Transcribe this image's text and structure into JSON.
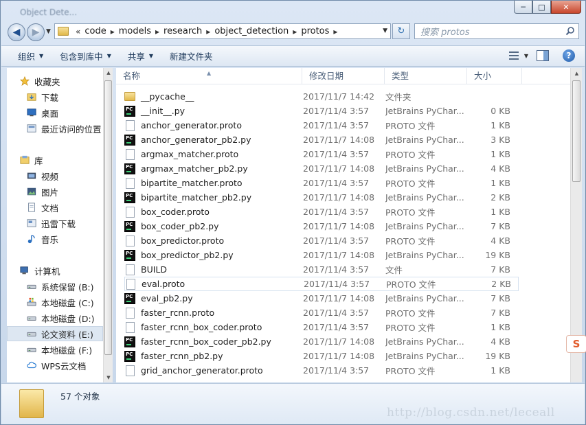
{
  "window": {
    "title": "Object Dete...",
    "controls": {
      "minimize": "─",
      "maximize": "□",
      "close": "✕"
    }
  },
  "navigation": {
    "back_icon": "arrow-left-icon",
    "forward_icon": "arrow-right-icon",
    "breadcrumb": [
      "code",
      "models",
      "research",
      "object_detection",
      "protos"
    ],
    "overflow": "«",
    "search_placeholder": "搜索 protos"
  },
  "toolbar": {
    "organize": "组织",
    "include_in_library": "包含到库中",
    "share": "共享",
    "new_folder": "新建文件夹"
  },
  "sidebar": {
    "items": [
      {
        "label": "收藏夹",
        "icon": "star-icon"
      },
      {
        "label": "下载",
        "icon": "download-folder-icon"
      },
      {
        "label": "桌面",
        "icon": "desktop-icon"
      },
      {
        "label": "最近访问的位置",
        "icon": "recent-places-icon"
      },
      {
        "label": "库",
        "icon": "library-icon"
      },
      {
        "label": "视频",
        "icon": "video-icon"
      },
      {
        "label": "图片",
        "icon": "picture-icon"
      },
      {
        "label": "文档",
        "icon": "document-icon"
      },
      {
        "label": "迅雷下载",
        "icon": "thunder-download-icon"
      },
      {
        "label": "音乐",
        "icon": "music-icon"
      },
      {
        "label": "计算机",
        "icon": "computer-icon"
      },
      {
        "label": "系统保留 (B:)",
        "icon": "drive-icon"
      },
      {
        "label": "本地磁盘 (C:)",
        "icon": "system-drive-icon"
      },
      {
        "label": "本地磁盘 (D:)",
        "icon": "drive-icon"
      },
      {
        "label": "论文资料 (E:)",
        "icon": "drive-icon"
      },
      {
        "label": "本地磁盘 (F:)",
        "icon": "drive-icon"
      },
      {
        "label": "WPS云文档",
        "icon": "cloud-icon"
      }
    ]
  },
  "file_list": {
    "columns": {
      "name": "名称",
      "date": "修改日期",
      "type": "类型",
      "size": "大小"
    },
    "rows": [
      {
        "name": "__pycache__",
        "date": "2017/11/7 14:42",
        "type": "文件夹",
        "size": "",
        "icon": "folder"
      },
      {
        "name": "__init__.py",
        "date": "2017/11/4 3:57",
        "type": "JetBrains PyChar...",
        "size": "0 KB",
        "icon": "pc"
      },
      {
        "name": "anchor_generator.proto",
        "date": "2017/11/4 3:57",
        "type": "PROTO 文件",
        "size": "1 KB",
        "icon": "doc"
      },
      {
        "name": "anchor_generator_pb2.py",
        "date": "2017/11/7 14:08",
        "type": "JetBrains PyChar...",
        "size": "3 KB",
        "icon": "pc"
      },
      {
        "name": "argmax_matcher.proto",
        "date": "2017/11/4 3:57",
        "type": "PROTO 文件",
        "size": "1 KB",
        "icon": "doc"
      },
      {
        "name": "argmax_matcher_pb2.py",
        "date": "2017/11/7 14:08",
        "type": "JetBrains PyChar...",
        "size": "4 KB",
        "icon": "pc"
      },
      {
        "name": "bipartite_matcher.proto",
        "date": "2017/11/4 3:57",
        "type": "PROTO 文件",
        "size": "1 KB",
        "icon": "doc"
      },
      {
        "name": "bipartite_matcher_pb2.py",
        "date": "2017/11/7 14:08",
        "type": "JetBrains PyChar...",
        "size": "2 KB",
        "icon": "pc"
      },
      {
        "name": "box_coder.proto",
        "date": "2017/11/4 3:57",
        "type": "PROTO 文件",
        "size": "1 KB",
        "icon": "doc"
      },
      {
        "name": "box_coder_pb2.py",
        "date": "2017/11/7 14:08",
        "type": "JetBrains PyChar...",
        "size": "7 KB",
        "icon": "pc"
      },
      {
        "name": "box_predictor.proto",
        "date": "2017/11/4 3:57",
        "type": "PROTO 文件",
        "size": "4 KB",
        "icon": "doc"
      },
      {
        "name": "box_predictor_pb2.py",
        "date": "2017/11/7 14:08",
        "type": "JetBrains PyChar...",
        "size": "19 KB",
        "icon": "pc"
      },
      {
        "name": "BUILD",
        "date": "2017/11/4 3:57",
        "type": "文件",
        "size": "7 KB",
        "icon": "doc"
      },
      {
        "name": "eval.proto",
        "date": "2017/11/4 3:57",
        "type": "PROTO 文件",
        "size": "2 KB",
        "icon": "doc"
      },
      {
        "name": "eval_pb2.py",
        "date": "2017/11/7 14:08",
        "type": "JetBrains PyChar...",
        "size": "7 KB",
        "icon": "pc"
      },
      {
        "name": "faster_rcnn.proto",
        "date": "2017/11/4 3:57",
        "type": "PROTO 文件",
        "size": "7 KB",
        "icon": "doc"
      },
      {
        "name": "faster_rcnn_box_coder.proto",
        "date": "2017/11/4 3:57",
        "type": "PROTO 文件",
        "size": "1 KB",
        "icon": "doc"
      },
      {
        "name": "faster_rcnn_box_coder_pb2.py",
        "date": "2017/11/7 14:08",
        "type": "JetBrains PyChar...",
        "size": "4 KB",
        "icon": "pc"
      },
      {
        "name": "faster_rcnn_pb2.py",
        "date": "2017/11/7 14:08",
        "type": "JetBrains PyChar...",
        "size": "19 KB",
        "icon": "pc"
      },
      {
        "name": "grid_anchor_generator.proto",
        "date": "2017/11/4 3:57",
        "type": "PROTO 文件",
        "size": "1 KB",
        "icon": "doc"
      }
    ]
  },
  "status": {
    "count": "57 个对象"
  },
  "watermark": "http://blog.csdn.net/leceall",
  "sogou_badge": "S"
}
